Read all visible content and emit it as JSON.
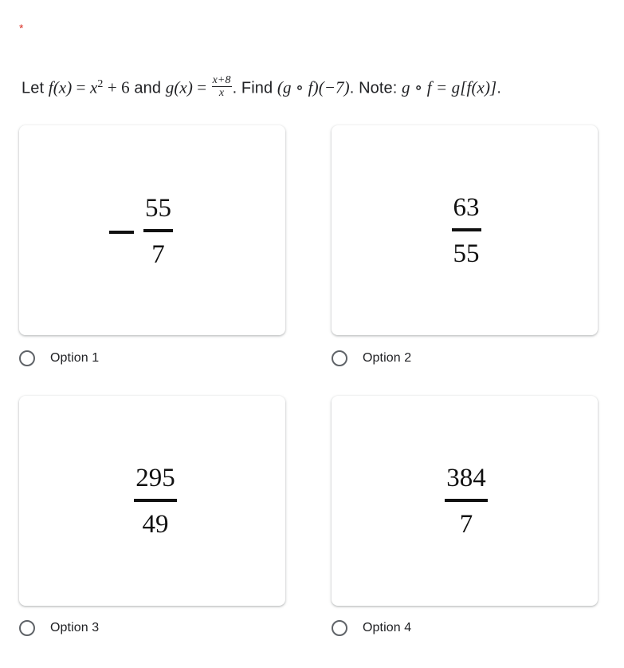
{
  "question": {
    "required_marker": "*",
    "text_let": "Let ",
    "f_of_x": "f(x)",
    "eq1": " = ",
    "x_var": "x",
    "exponent": "2",
    "plus6": " + 6",
    "and_text": " and ",
    "g_of_x": "g(x)",
    "eq2": " = ",
    "g_numerator": "x+8",
    "g_denominator": "x",
    "period1": ". ",
    "find_text": " Find ",
    "composition": "(g ∘ f)(−7)",
    "period2": ". ",
    "note_text": "Note: ",
    "note_expr": "g ∘ f = g[f(x)]",
    "period3": "."
  },
  "options": [
    {
      "label": "Option 1",
      "selected": false,
      "answer": {
        "sign": "-",
        "numerator": "55",
        "denominator": "7"
      }
    },
    {
      "label": "Option 2",
      "selected": false,
      "answer": {
        "sign": "",
        "numerator": "63",
        "denominator": "55"
      }
    },
    {
      "label": "Option 3",
      "selected": false,
      "answer": {
        "sign": "",
        "numerator": "295",
        "denominator": "49"
      }
    },
    {
      "label": "Option 4",
      "selected": false,
      "answer": {
        "sign": "",
        "numerator": "384",
        "denominator": "7"
      }
    }
  ],
  "colors": {
    "required_marker": "#d93025",
    "radio_border": "#5f6368",
    "text": "#202124"
  }
}
